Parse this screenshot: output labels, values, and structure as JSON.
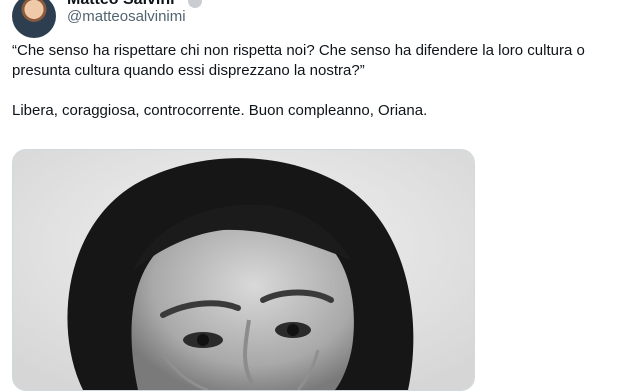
{
  "tweet": {
    "author": {
      "display_name": "Matteo Salvini",
      "handle": "@matteosalvinimi",
      "verified_icon": "verified-badge-icon"
    },
    "text_lines": [
      "“Che senso ha rispettare chi non rispetta noi? Che senso ha difendere la loro cultura o presunta cultura quando essi disprezzano la nostra?”",
      "Libera, coraggiosa, controcorrente. Buon compleanno, Oriana."
    ],
    "media": {
      "kind": "photo",
      "style": "black-and-white portrait"
    }
  }
}
